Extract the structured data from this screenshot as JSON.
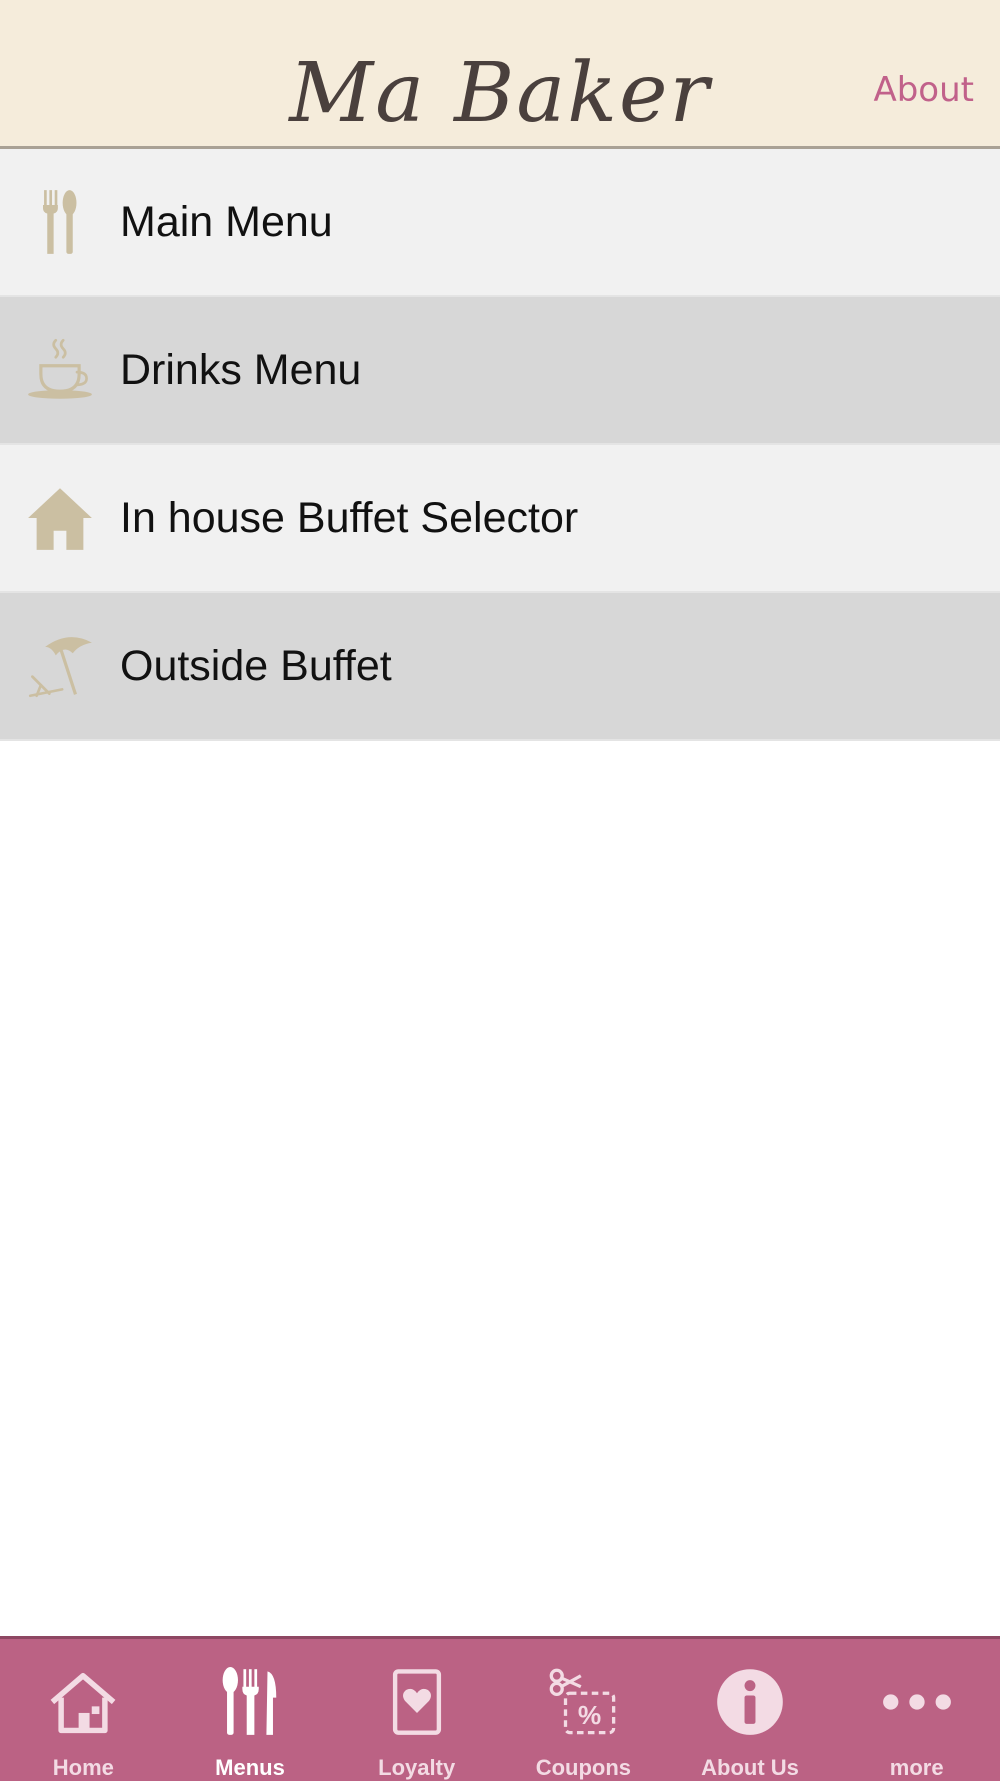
{
  "header": {
    "title": "Ma Baker",
    "about_label": "About"
  },
  "menu": [
    {
      "label": "Main Menu",
      "icon": "cutlery-icon"
    },
    {
      "label": "Drinks Menu",
      "icon": "coffee-cup-icon"
    },
    {
      "label": "In house Buffet Selector",
      "icon": "house-icon"
    },
    {
      "label": "Outside Buffet",
      "icon": "beach-umbrella-icon"
    }
  ],
  "tabs": [
    {
      "label": "Home",
      "icon": "home-icon"
    },
    {
      "label": "Menus",
      "icon": "cutlery-icon",
      "active": true
    },
    {
      "label": "Loyalty",
      "icon": "loyalty-card-icon"
    },
    {
      "label": "Coupons",
      "icon": "coupon-icon"
    },
    {
      "label": "About Us",
      "icon": "info-icon"
    },
    {
      "label": "more",
      "icon": "more-dots-icon"
    }
  ],
  "colors": {
    "header_bg": "#f5ecdb",
    "accent": "#bb6284",
    "icon_tan": "#cbbfa2",
    "about_link": "#c1618a"
  }
}
